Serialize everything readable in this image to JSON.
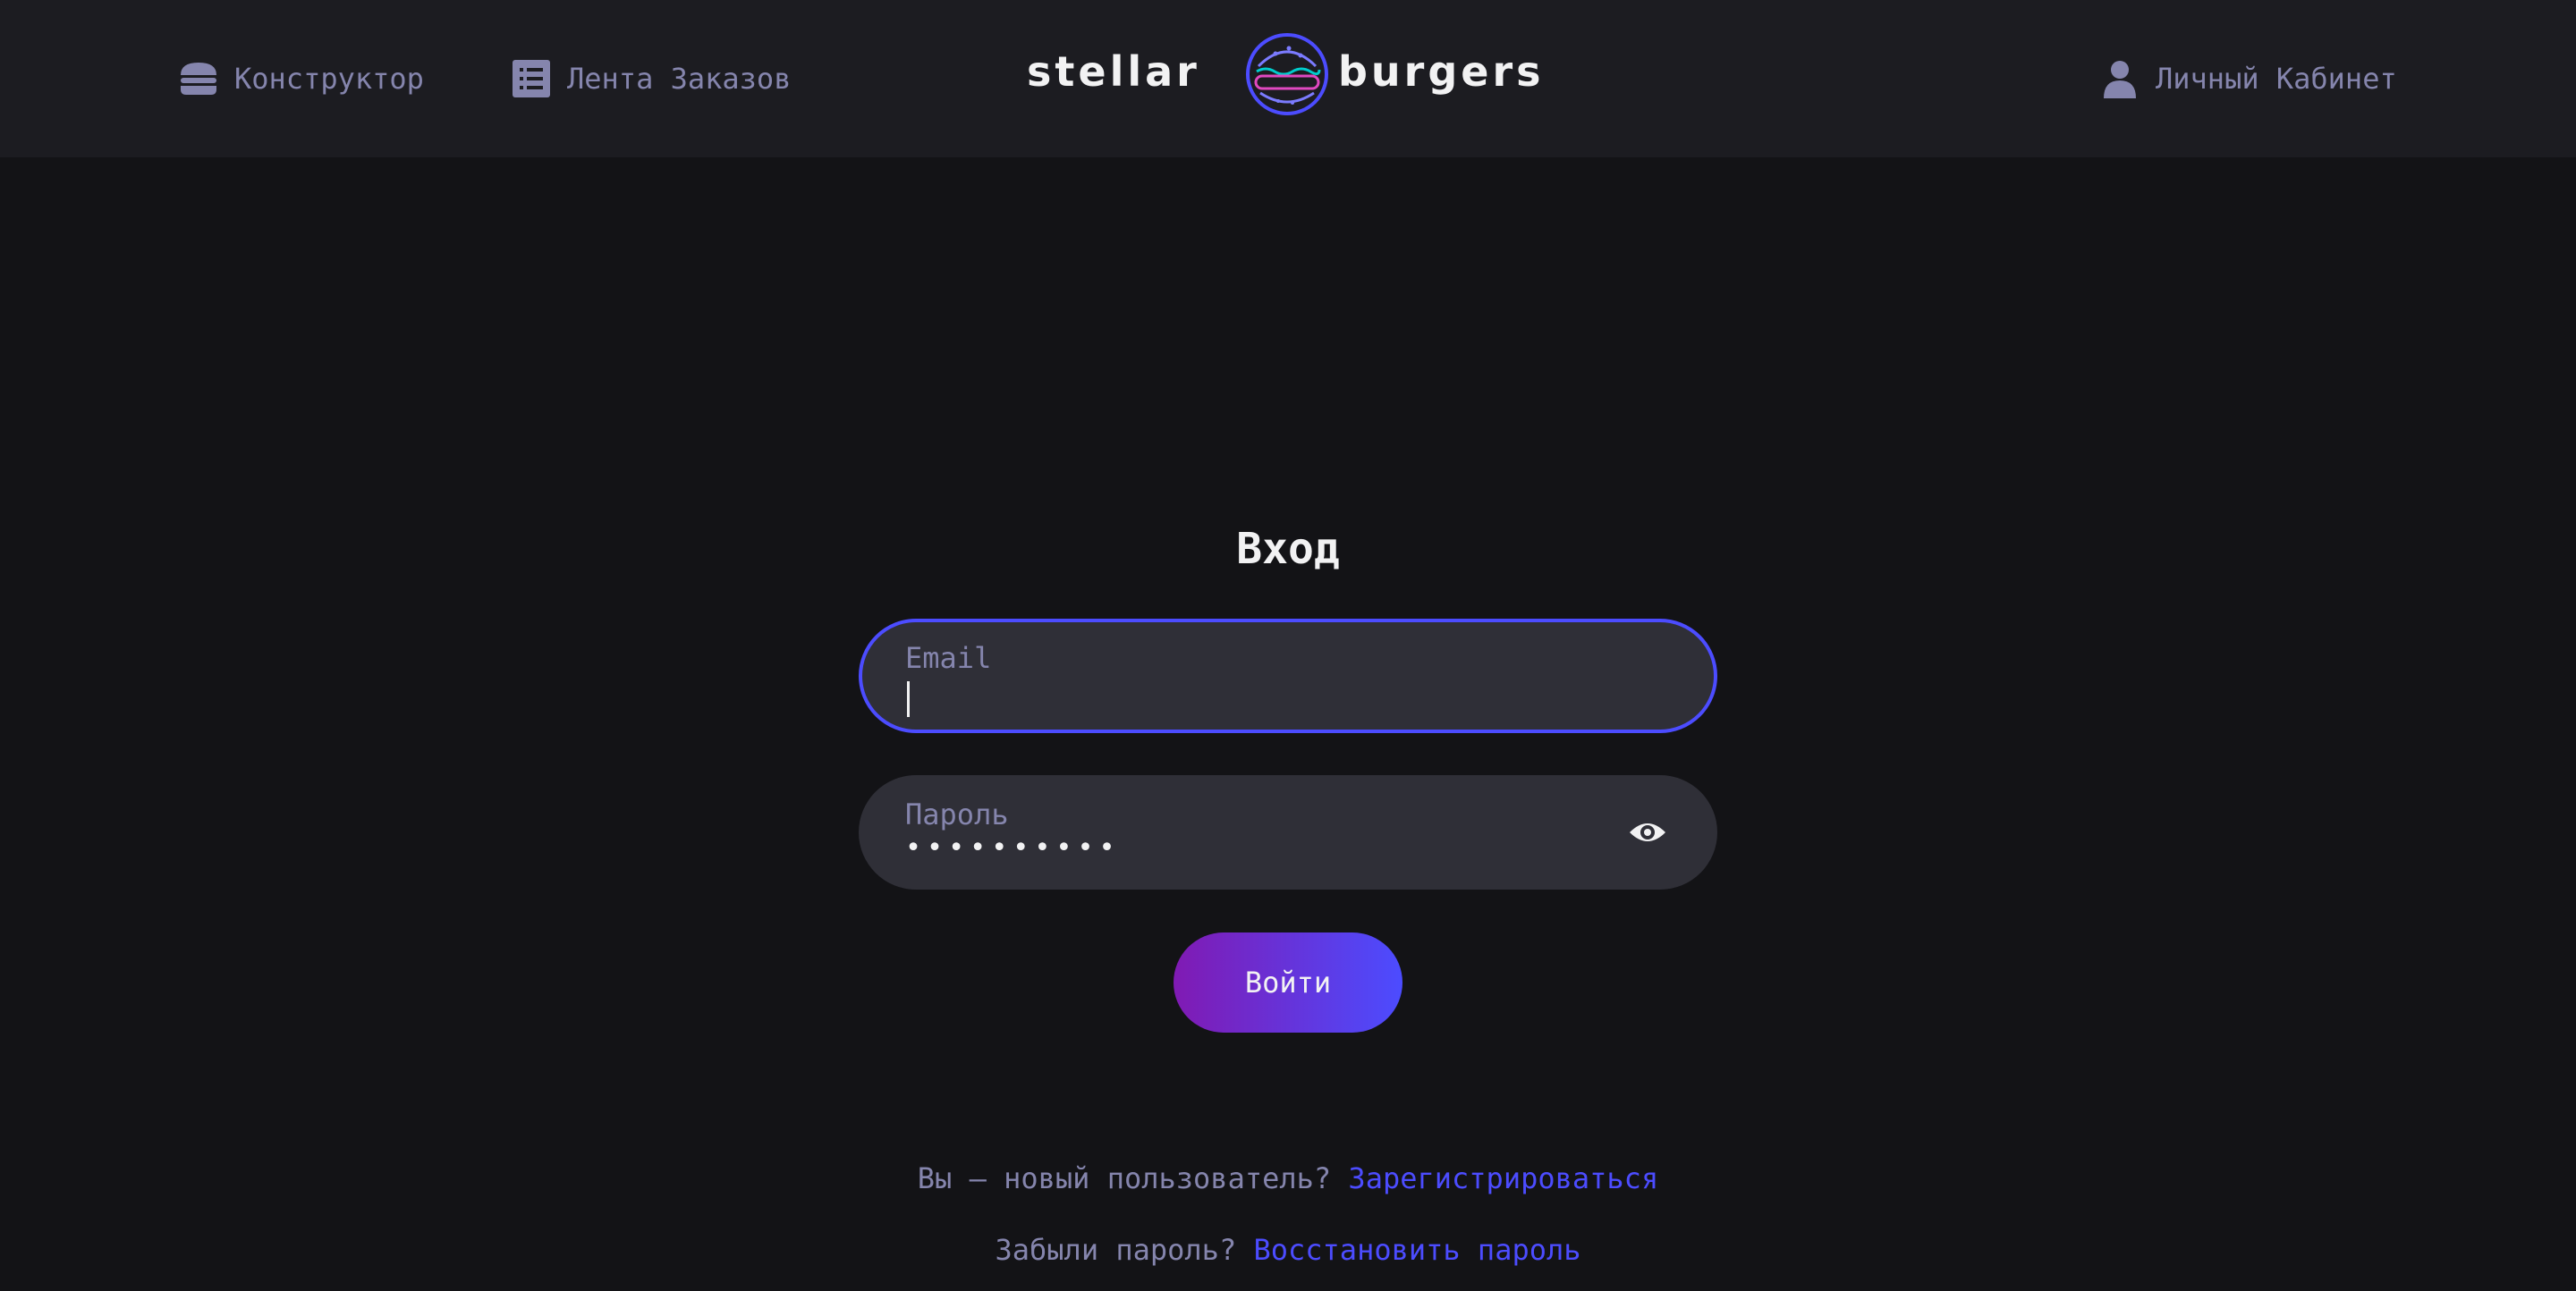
{
  "header": {
    "nav": {
      "constructor_label": "Конструктор",
      "feed_label": "Лента Заказов",
      "account_label": "Личный Кабинет"
    },
    "logo": {
      "left_text": "stellar",
      "right_text": "burgers"
    }
  },
  "login": {
    "title": "Вход",
    "email": {
      "label": "Email",
      "value": ""
    },
    "password": {
      "label": "Пароль",
      "masked_value": "••••••••••"
    },
    "submit_label": "Войти"
  },
  "footer_links": {
    "register_prompt": "Вы — новый пользователь?",
    "register_link": "Зарегистрироваться",
    "restore_prompt": "Забыли пароль?",
    "restore_link": "Восстановить пароль"
  },
  "colors": {
    "background": "#131316",
    "header_background": "#1c1c21",
    "input_background": "#2f2f37",
    "accent": "#4c4cff",
    "accent_purple": "#801ab3",
    "muted_text": "#8585ad",
    "primary_text": "#f2f2f3"
  },
  "icons": {
    "constructor": "burger-icon",
    "feed": "list-icon",
    "account": "profile-icon",
    "password_toggle": "eye-icon"
  }
}
